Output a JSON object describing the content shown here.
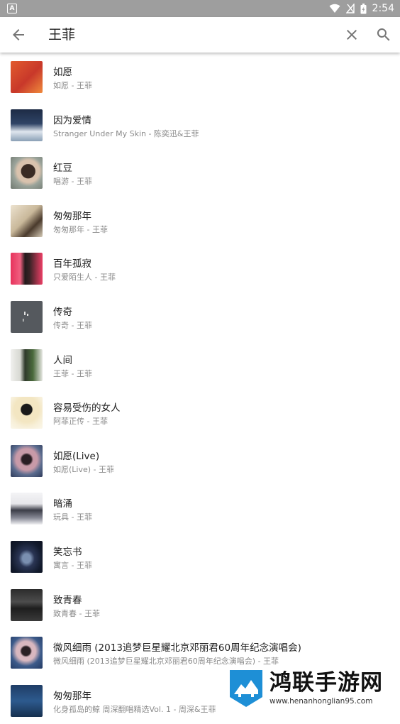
{
  "status_bar": {
    "badge": "A",
    "time": "2:54"
  },
  "toolbar": {
    "query": "王菲"
  },
  "results": [
    {
      "title": "如愿",
      "subtitle": "如愿 - 王菲"
    },
    {
      "title": "因为爱情",
      "subtitle": "Stranger Under My Skin - 陈奕迅&王菲"
    },
    {
      "title": "红豆",
      "subtitle": "唱游 - 王菲"
    },
    {
      "title": "匆匆那年",
      "subtitle": "匆匆那年 - 王菲"
    },
    {
      "title": "百年孤寂",
      "subtitle": "只爱陌生人 - 王菲"
    },
    {
      "title": "传奇",
      "subtitle": "传奇 - 王菲"
    },
    {
      "title": "人间",
      "subtitle": "王菲 - 王菲"
    },
    {
      "title": "容易受伤的女人",
      "subtitle": "阿菲正传 - 王菲"
    },
    {
      "title": "如愿(Live)",
      "subtitle": "如愿(Live) - 王菲"
    },
    {
      "title": "暗涌",
      "subtitle": "玩具 - 王菲"
    },
    {
      "title": "笑忘书",
      "subtitle": "寓言 - 王菲"
    },
    {
      "title": "致青春",
      "subtitle": "致青春 - 王菲"
    },
    {
      "title": "微风细雨 (2013追梦巨星耀北京邓丽君60周年纪念演唱会)",
      "subtitle": "微风细雨 (2013追梦巨星耀北京邓丽君60周年纪念演唱会) - 王菲"
    },
    {
      "title": "匆匆那年",
      "subtitle": "化身孤岛的鲸 周深翻唱精选Vol. 1 - 周深&王菲"
    }
  ],
  "watermark": {
    "name": "鸿联手游网",
    "url": "www.henanhonglian95.com"
  }
}
